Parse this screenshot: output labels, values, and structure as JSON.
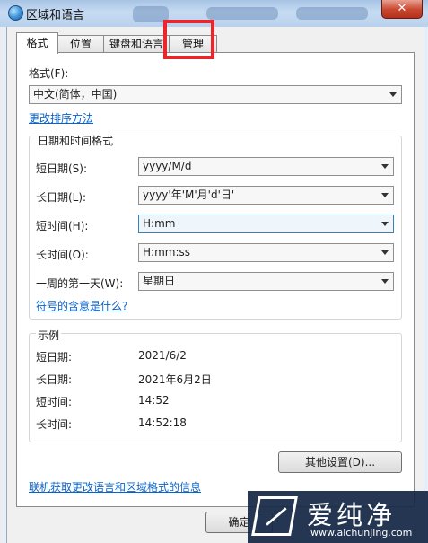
{
  "window": {
    "title": "区域和语言",
    "close_label": "✕",
    "icon": "globe-icon"
  },
  "tabs": [
    {
      "label": "格式",
      "active": true
    },
    {
      "label": "位置",
      "active": false
    },
    {
      "label": "键盘和语言",
      "active": false
    },
    {
      "label": "管理",
      "active": false
    }
  ],
  "highlight": {
    "color": "#e8262b",
    "target": "管理"
  },
  "format": {
    "label": "格式(F):",
    "value": "中文(简体，中国)",
    "change_sort_link": "更改排序方法"
  },
  "datetime": {
    "group_title": "日期和时间格式",
    "rows": [
      {
        "label": "短日期(S):",
        "value": "yyyy/M/d"
      },
      {
        "label": "长日期(L):",
        "value": "yyyy'年'M'月'd'日'"
      },
      {
        "label": "短时间(H):",
        "value": "H:mm"
      },
      {
        "label": "长时间(O):",
        "value": "H:mm:ss"
      },
      {
        "label": "一周的第一天(W):",
        "value": "星期日"
      }
    ],
    "symbols_link": "符号的含意是什么?"
  },
  "examples": {
    "group_title": "示例",
    "rows": [
      {
        "label": "短日期:",
        "value": "2021/6/2"
      },
      {
        "label": "长日期:",
        "value": "2021年6月2日"
      },
      {
        "label": "短时间:",
        "value": "14:52"
      },
      {
        "label": "长时间:",
        "value": "14:52:18"
      }
    ]
  },
  "other_settings_button": "其他设置(D)...",
  "online_link": "联机获取更改语言和区域格式的信息",
  "ok_button": "确定",
  "watermark": {
    "brand": "爱纯净",
    "url": "www.aichunjing.com"
  }
}
